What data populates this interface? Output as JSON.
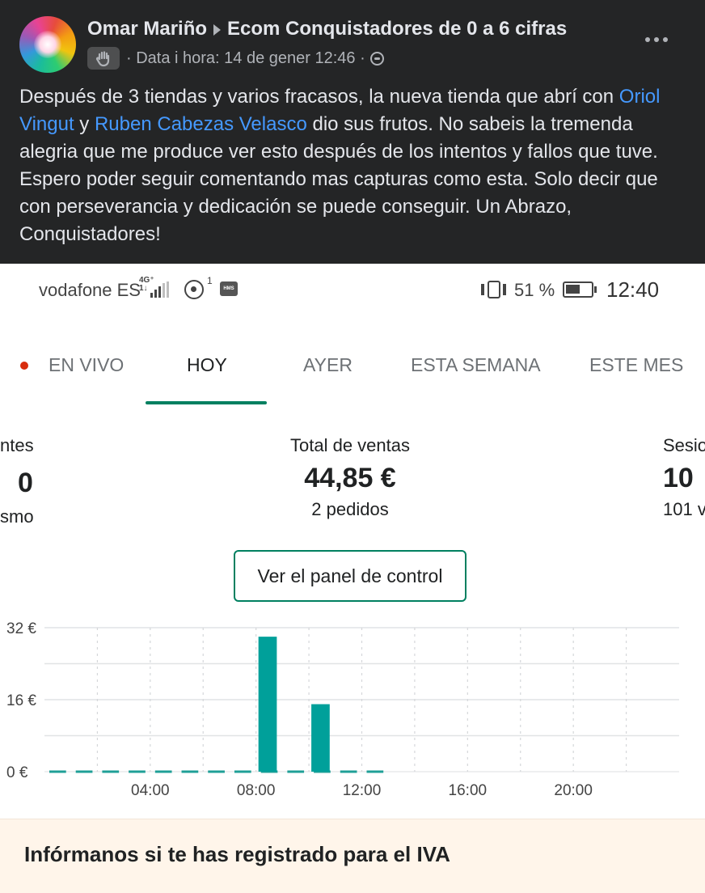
{
  "post": {
    "author": "Omar Mariño",
    "group": "Ecom Conquistadores de 0 a 6 cifras",
    "meta": "· Data i hora: 14 de gener 12:46 ·",
    "text_1": "Después de 3 tiendas y varios fracasos, la nueva tienda que abrí con ",
    "mention_1": "Oriol Vingut",
    "text_2": " y ",
    "mention_2": "Ruben Cabezas Velasco",
    "text_3": "  dio sus frutos. No sabeis la tremenda alegria que me produce ver esto después de los intentos y fallos que tuve. Espero poder seguir comentando mas capturas como esta. Solo decir que con perseverancia y dedicación se puede conseguir. Un Abrazo, Conquistadores!"
  },
  "status_bar": {
    "carrier": "vodafone ES",
    "network": "4G⁺",
    "network_sub": "1↓",
    "hotspot_count": "1",
    "hms_label": "HMS",
    "battery": "51 %",
    "time": "12:40"
  },
  "tabs": [
    {
      "label": "EN VIVO"
    },
    {
      "label": "HOY",
      "active": true
    },
    {
      "label": "AYER"
    },
    {
      "label": "ESTA SEMANA"
    },
    {
      "label": "ESTE MES"
    }
  ],
  "metrics": {
    "left": {
      "label": "ntes",
      "value": "0",
      "sub": "smo"
    },
    "center": {
      "label": "Total de ventas",
      "value": "44,85 €",
      "sub": "2 pedidos"
    },
    "right": {
      "label": "Sesio",
      "value": "10",
      "sub": "101 v"
    }
  },
  "button_label": "Ver el panel de control",
  "chart_data": {
    "type": "bar",
    "y_ticks": [
      "32 €",
      "16 €",
      "0 €"
    ],
    "x_ticks": [
      "04:00",
      "08:00",
      "12:00",
      "16:00",
      "20:00"
    ],
    "ylim": [
      0,
      32
    ],
    "hours_shown": 24,
    "series": [
      {
        "hour_start": 8,
        "value": 30
      },
      {
        "hour_start": 10,
        "value": 15
      }
    ],
    "zero_dashes_through_hour": 13,
    "colors": {
      "bar": "#00a09a",
      "grid": "#e1e3e5",
      "zero_line": "#1f9f97"
    }
  },
  "banner": {
    "title": "Infórmanos si te has registrado para el IVA"
  }
}
